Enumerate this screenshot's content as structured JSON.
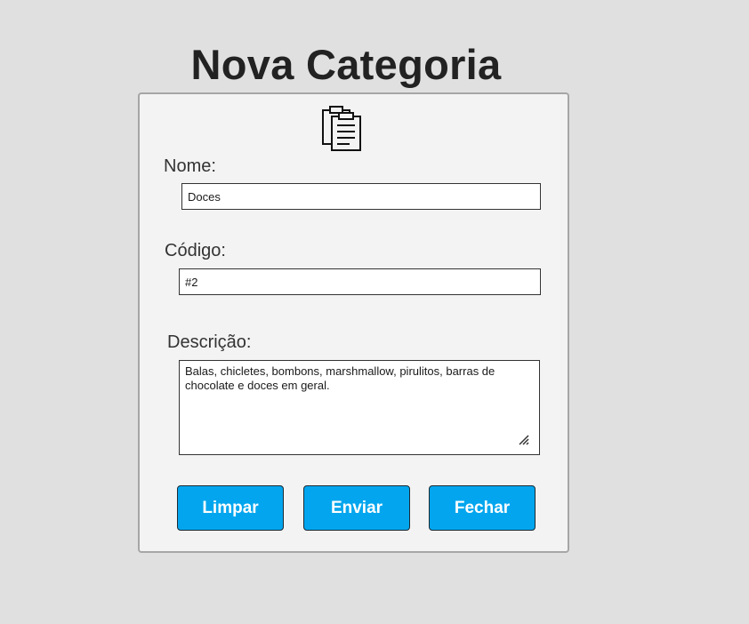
{
  "page_title": "Nova Categoria",
  "icon": "clipboard-icon",
  "form": {
    "nome": {
      "label": "Nome:",
      "value": "Doces"
    },
    "codigo": {
      "label": "Código:",
      "value": "#2"
    },
    "descricao": {
      "label": "Descrição:",
      "value": "Balas, chicletes, bombons, marshmallow, pirulitos, barras de chocolate e doces em geral."
    }
  },
  "buttons": {
    "limpar": "Limpar",
    "enviar": "Enviar",
    "fechar": "Fechar"
  },
  "colors": {
    "background": "#e0e0e0",
    "card": "#f3f3f3",
    "button": "#03a6ee",
    "button_text": "#ffffff"
  }
}
